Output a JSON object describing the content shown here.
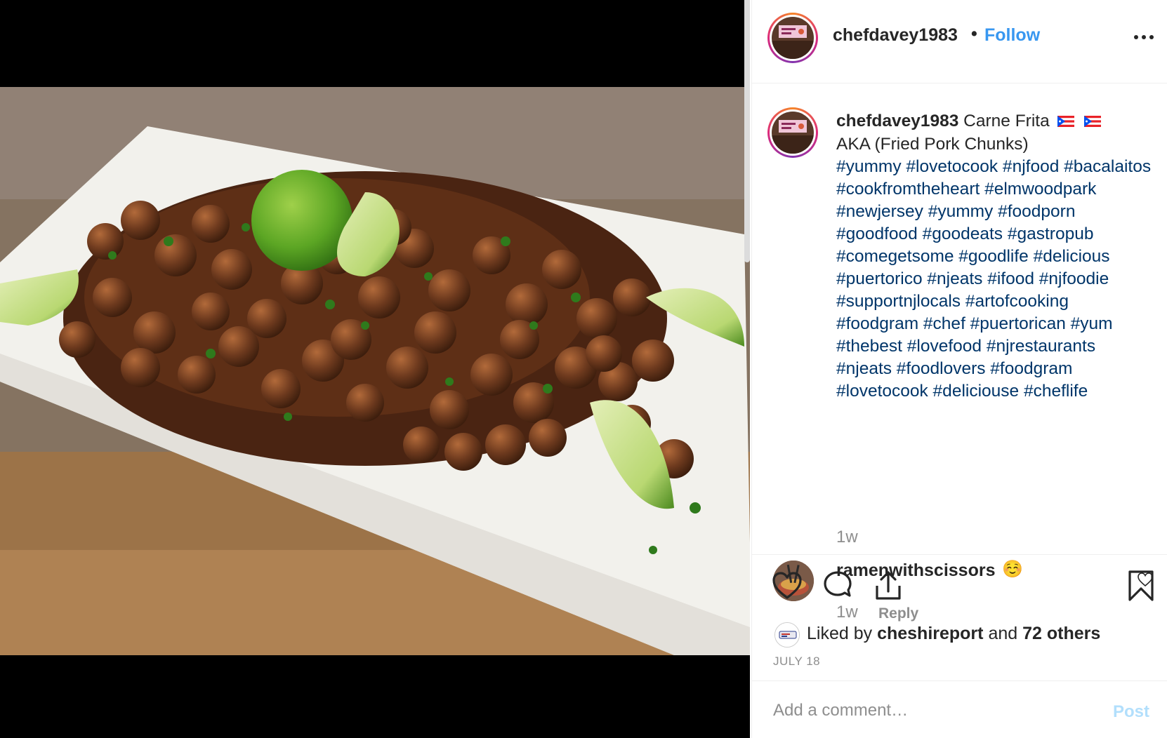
{
  "post": {
    "image_alt": "Plate of carne frita with lime wedges and cilantro",
    "header": {
      "username": "chefdavey1983",
      "separator": "•",
      "follow_label": "Follow",
      "more_icon": "more-horizontal-icon"
    },
    "caption": {
      "username": "chefdavey1983",
      "text_line1": "Carne Frita",
      "text_line2": "AKA (Fried Pork Chunks)",
      "hashtags": "#yummy #lovetocook #njfood #bacalaitos #cookfromtheheart #elmwoodpark #newjersey #yummy #foodporn #goodfood #goodeats #gastropub #comegetsome #goodlife #delicious #puertorico #njeats #ifood #njfoodie #supportnjlocals #artofcooking #foodgram #chef #puertorican #yum #thebest #lovefood #njrestaurants #njeats #foodlovers #foodgram #lovetocook #deliciouse #cheflife",
      "time": "1w"
    },
    "comments": [
      {
        "username": "ramenwithscissors",
        "emoji": "☺️",
        "time": "1w",
        "reply_label": "Reply"
      }
    ],
    "actions": {
      "like_icon": "heart-icon",
      "comment_icon": "comment-icon",
      "share_icon": "share-icon",
      "save_icon": "bookmark-icon"
    },
    "likes": {
      "prefix": "Liked by ",
      "user": "cheshireport",
      "middle": " and ",
      "others": "72 others"
    },
    "date": "JULY 18",
    "add_comment": {
      "placeholder": "Add a comment…",
      "post_label": "Post"
    }
  },
  "colors": {
    "link_blue": "#3897f0",
    "hashtag_blue": "#003569",
    "muted": "#8e8e8e",
    "post_disabled": "#b2dffc"
  }
}
